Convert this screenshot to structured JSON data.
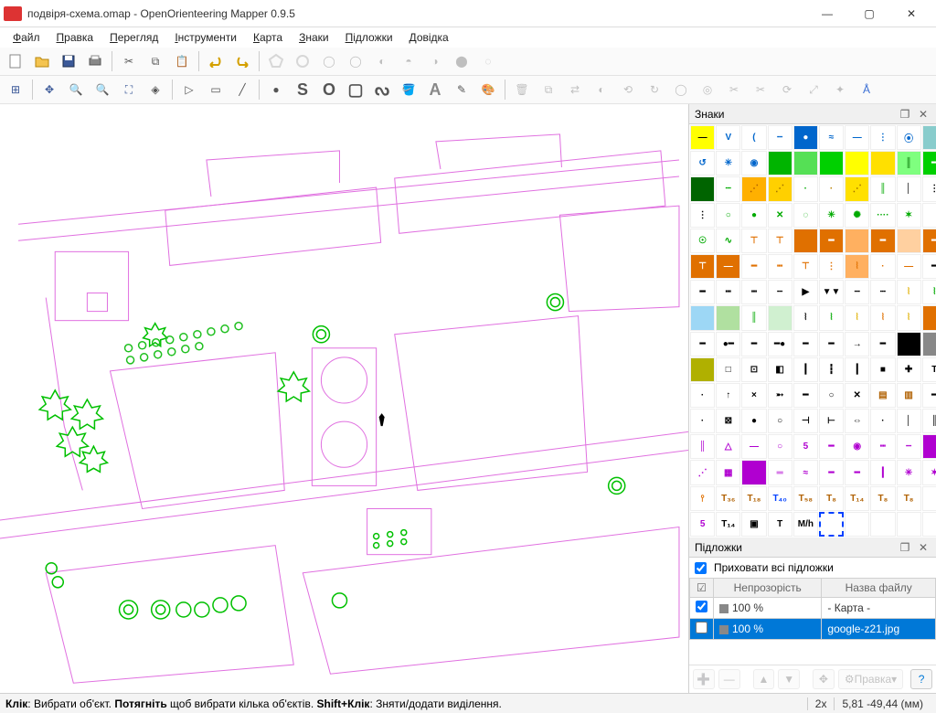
{
  "window": {
    "title": "подвіря-схема.omap - OpenOrienteering Mapper 0.9.5"
  },
  "menu": [
    "Файл",
    "Правка",
    "Перегляд",
    "Інструменти",
    "Карта",
    "Знаки",
    "Підложки",
    "Довідка"
  ],
  "panels": {
    "symbols_title": "Знаки",
    "templates_title": "Підложки",
    "hide_all_label": "Приховати всі підложки",
    "hide_all_checked": true
  },
  "templates_table": {
    "headers": [
      "",
      "Непрозорість",
      "Назва файлу"
    ],
    "rows": [
      {
        "checked": true,
        "opacity": "100 %",
        "name": "- Карта -",
        "selected": false
      },
      {
        "checked": false,
        "opacity": "100 %",
        "name": "google-z21.jpg",
        "selected": true
      }
    ]
  },
  "templates_actions": {
    "edit_label": "Правка"
  },
  "statusbar": {
    "hint_html": "<b>Клік</b>: Вибрати об'єкт. <b>Потягніть</b> щоб вибрати кілька об'єктів. <b>Shift+Клік</b>: Зняти/додати виділення.",
    "zoom": "2x",
    "coords": "5,81 -49,44 (мм)"
  },
  "symbols": [
    {
      "bg": "#ff0",
      "fg": "#000",
      "t": "—"
    },
    {
      "bg": "#fff",
      "fg": "#0066cc",
      "t": "V"
    },
    {
      "bg": "#fff",
      "fg": "#0066cc",
      "t": "("
    },
    {
      "bg": "#fff",
      "fg": "#0066cc",
      "t": "┄"
    },
    {
      "bg": "#0066cc",
      "fg": "#fff",
      "t": "●"
    },
    {
      "bg": "#fff",
      "fg": "#0066cc",
      "t": "≈"
    },
    {
      "bg": "#fff",
      "fg": "#0066cc",
      "t": "—"
    },
    {
      "bg": "#fff",
      "fg": "#0066cc",
      "t": "⋮"
    },
    {
      "bg": "#fff",
      "fg": "#0066cc",
      "t": "⦿"
    },
    {
      "bg": "#8cc",
      "fg": "#fff",
      "t": ""
    },
    {
      "bg": "#fff",
      "fg": "#06c",
      "t": "↺"
    },
    {
      "bg": "#fff",
      "fg": "#06c",
      "t": "✳"
    },
    {
      "bg": "#fff",
      "fg": "#06c",
      "t": "◉"
    },
    {
      "bg": "#00b400",
      "fg": "#fff",
      "t": ""
    },
    {
      "bg": "#55e055",
      "fg": "#fff",
      "t": ""
    },
    {
      "bg": "#00d000",
      "fg": "#fff",
      "t": ""
    },
    {
      "bg": "#ff0",
      "fg": "#000",
      "t": ""
    },
    {
      "bg": "#ffe000",
      "fg": "#000",
      "t": ""
    },
    {
      "bg": "#7fff7f",
      "fg": "#007000",
      "t": "║"
    },
    {
      "bg": "#00d000",
      "fg": "#fff",
      "t": "━"
    },
    {
      "bg": "#006400",
      "fg": "#fff",
      "t": ""
    },
    {
      "bg": "#fff",
      "fg": "#0a0",
      "t": "┈"
    },
    {
      "bg": "#ffb000",
      "fg": "#b06000",
      "t": "⋰"
    },
    {
      "bg": "#ffd000",
      "fg": "#a07000",
      "t": "⋰"
    },
    {
      "bg": "#fff",
      "fg": "#0a0",
      "t": "·"
    },
    {
      "bg": "#fff",
      "fg": "#b88000",
      "t": "·"
    },
    {
      "bg": "#ffe000",
      "fg": "#a07000",
      "t": "⋰"
    },
    {
      "bg": "#fff",
      "fg": "#0a0",
      "t": "║"
    },
    {
      "bg": "#fff",
      "fg": "#000",
      "t": "│"
    },
    {
      "bg": "#fff",
      "fg": "#000",
      "t": "⋮"
    },
    {
      "bg": "#fff",
      "fg": "#000",
      "t": "⋮"
    },
    {
      "bg": "#fff",
      "fg": "#0a0",
      "t": "○"
    },
    {
      "bg": "#fff",
      "fg": "#0a0",
      "t": "●"
    },
    {
      "bg": "#fff",
      "fg": "#0a0",
      "t": "✕"
    },
    {
      "bg": "#fff",
      "fg": "#0a0",
      "t": "◌"
    },
    {
      "bg": "#fff",
      "fg": "#0a0",
      "t": "✳"
    },
    {
      "bg": "#fff",
      "fg": "#0a0",
      "t": "✺"
    },
    {
      "bg": "#fff",
      "fg": "#0a0",
      "t": "····"
    },
    {
      "bg": "#fff",
      "fg": "#0a0",
      "t": "✶"
    },
    {
      "bg": "#fff",
      "fg": "#000",
      "t": ""
    },
    {
      "bg": "#fff",
      "fg": "#0a0",
      "t": "☉"
    },
    {
      "bg": "#fff",
      "fg": "#0a0",
      "t": "∿"
    },
    {
      "bg": "#fff",
      "fg": "#e07000",
      "t": "⊤"
    },
    {
      "bg": "#fff",
      "fg": "#e07000",
      "t": "⊤"
    },
    {
      "bg": "#e07000",
      "fg": "#fff",
      "t": ""
    },
    {
      "bg": "#e07000",
      "fg": "#fff",
      "t": "━"
    },
    {
      "bg": "#ffb060",
      "fg": "#fff",
      "t": ""
    },
    {
      "bg": "#e07000",
      "fg": "#fff",
      "t": "━"
    },
    {
      "bg": "#ffd0a0",
      "fg": "#fff",
      "t": ""
    },
    {
      "bg": "#e07000",
      "fg": "#fff",
      "t": "━"
    },
    {
      "bg": "#e07000",
      "fg": "#fff",
      "t": "⊤"
    },
    {
      "bg": "#e07000",
      "fg": "#fff",
      "t": "—"
    },
    {
      "bg": "#fff",
      "fg": "#e07000",
      "t": "━"
    },
    {
      "bg": "#fff",
      "fg": "#e07000",
      "t": "┉"
    },
    {
      "bg": "#fff",
      "fg": "#e07000",
      "t": "⊤"
    },
    {
      "bg": "#fff",
      "fg": "#e07000",
      "t": "⋮"
    },
    {
      "bg": "#ffb060",
      "fg": "#e07000",
      "t": "⦚"
    },
    {
      "bg": "#fff",
      "fg": "#e07000",
      "t": "·"
    },
    {
      "bg": "#fff",
      "fg": "#e07000",
      "t": "—"
    },
    {
      "bg": "#fff",
      "fg": "#000",
      "t": "━"
    },
    {
      "bg": "#fff",
      "fg": "#000",
      "t": "━"
    },
    {
      "bg": "#fff",
      "fg": "#000",
      "t": "┉"
    },
    {
      "bg": "#fff",
      "fg": "#000",
      "t": "┉"
    },
    {
      "bg": "#fff",
      "fg": "#000",
      "t": "┄"
    },
    {
      "bg": "#fff",
      "fg": "#000",
      "t": "▶"
    },
    {
      "bg": "#fff",
      "fg": "#000",
      "t": "▼▼"
    },
    {
      "bg": "#fff",
      "fg": "#000",
      "t": "┄"
    },
    {
      "bg": "#fff",
      "fg": "#000",
      "t": "┄"
    },
    {
      "bg": "#fff",
      "fg": "#e0b000",
      "t": "⦚"
    },
    {
      "bg": "#fff",
      "fg": "#0a0",
      "t": "⦚"
    },
    {
      "bg": "#9dd7f5",
      "fg": "#fff",
      "t": ""
    },
    {
      "bg": "#b0e0a0",
      "fg": "#fff",
      "t": ""
    },
    {
      "bg": "#fff",
      "fg": "#0a0",
      "t": "║"
    },
    {
      "bg": "#d0f0d0",
      "fg": "#fff",
      "t": ""
    },
    {
      "bg": "#fff",
      "fg": "#000",
      "t": "⦚"
    },
    {
      "bg": "#fff",
      "fg": "#0a0",
      "t": "⦚"
    },
    {
      "bg": "#fff",
      "fg": "#e0b000",
      "t": "⦚"
    },
    {
      "bg": "#fff",
      "fg": "#e07000",
      "t": "⦚"
    },
    {
      "bg": "#fff",
      "fg": "#e0b000",
      "t": "⦚"
    },
    {
      "bg": "#e07000",
      "fg": "#fff",
      "t": ""
    },
    {
      "bg": "#fff",
      "fg": "#000",
      "t": "━"
    },
    {
      "bg": "#fff",
      "fg": "#000",
      "t": "●━"
    },
    {
      "bg": "#fff",
      "fg": "#000",
      "t": "━"
    },
    {
      "bg": "#fff",
      "fg": "#000",
      "t": "━●"
    },
    {
      "bg": "#fff",
      "fg": "#000",
      "t": "━"
    },
    {
      "bg": "#fff",
      "fg": "#000",
      "t": "━"
    },
    {
      "bg": "#fff",
      "fg": "#000",
      "t": "→"
    },
    {
      "bg": "#fff",
      "fg": "#000",
      "t": "━"
    },
    {
      "bg": "#000",
      "fg": "#fff",
      "t": ""
    },
    {
      "bg": "#888",
      "fg": "#fff",
      "t": ""
    },
    {
      "bg": "#b0b000",
      "fg": "#fff",
      "t": ""
    },
    {
      "bg": "#fff",
      "fg": "#000",
      "t": "□"
    },
    {
      "bg": "#fff",
      "fg": "#000",
      "t": "⊡"
    },
    {
      "bg": "#fff",
      "fg": "#000",
      "t": "◧"
    },
    {
      "bg": "#fff",
      "fg": "#000",
      "t": "┃"
    },
    {
      "bg": "#fff",
      "fg": "#000",
      "t": "┇"
    },
    {
      "bg": "#fff",
      "fg": "#000",
      "t": "┃"
    },
    {
      "bg": "#fff",
      "fg": "#000",
      "t": "■"
    },
    {
      "bg": "#fff",
      "fg": "#000",
      "t": "✚"
    },
    {
      "bg": "#fff",
      "fg": "#000",
      "t": "T"
    },
    {
      "bg": "#fff",
      "fg": "#000",
      "t": "·"
    },
    {
      "bg": "#fff",
      "fg": "#000",
      "t": "↑"
    },
    {
      "bg": "#fff",
      "fg": "#000",
      "t": "×"
    },
    {
      "bg": "#fff",
      "fg": "#000",
      "t": "➵"
    },
    {
      "bg": "#fff",
      "fg": "#000",
      "t": "━"
    },
    {
      "bg": "#fff",
      "fg": "#000",
      "t": "○"
    },
    {
      "bg": "#fff",
      "fg": "#000",
      "t": "✕"
    },
    {
      "bg": "#fff",
      "fg": "#b06000",
      "t": "▤"
    },
    {
      "bg": "#fff",
      "fg": "#b06000",
      "t": "▥"
    },
    {
      "bg": "#fff",
      "fg": "#000",
      "t": "━"
    },
    {
      "bg": "#fff",
      "fg": "#000",
      "t": "·"
    },
    {
      "bg": "#fff",
      "fg": "#000",
      "t": "⊠"
    },
    {
      "bg": "#fff",
      "fg": "#000",
      "t": "●"
    },
    {
      "bg": "#fff",
      "fg": "#000",
      "t": "○"
    },
    {
      "bg": "#fff",
      "fg": "#000",
      "t": "⊣"
    },
    {
      "bg": "#fff",
      "fg": "#000",
      "t": "⊢"
    },
    {
      "bg": "#fff",
      "fg": "#000",
      "t": "⇔"
    },
    {
      "bg": "#fff",
      "fg": "#000",
      "t": "·"
    },
    {
      "bg": "#fff",
      "fg": "#000",
      "t": "│"
    },
    {
      "bg": "#fff",
      "fg": "#000",
      "t": "║"
    },
    {
      "bg": "#fff",
      "fg": "#b000d0",
      "t": "║"
    },
    {
      "bg": "#fff",
      "fg": "#b000d0",
      "t": "△"
    },
    {
      "bg": "#fff",
      "fg": "#b000d0",
      "t": "—"
    },
    {
      "bg": "#fff",
      "fg": "#b000d0",
      "t": "○"
    },
    {
      "bg": "#fff",
      "fg": "#b000d0",
      "t": "5"
    },
    {
      "bg": "#fff",
      "fg": "#b000d0",
      "t": "━"
    },
    {
      "bg": "#fff",
      "fg": "#b000d0",
      "t": "◉"
    },
    {
      "bg": "#fff",
      "fg": "#b000d0",
      "t": "┉"
    },
    {
      "bg": "#fff",
      "fg": "#b000d0",
      "t": "┄"
    },
    {
      "bg": "#b000d0",
      "fg": "#fff",
      "t": ""
    },
    {
      "bg": "#fff",
      "fg": "#b000d0",
      "t": "⋰"
    },
    {
      "bg": "#fff",
      "fg": "#b000d0",
      "t": "▦"
    },
    {
      "bg": "#b000d0",
      "fg": "#fff",
      "t": ""
    },
    {
      "bg": "#fff",
      "fg": "#b000d0",
      "t": "═"
    },
    {
      "bg": "#fff",
      "fg": "#b000d0",
      "t": "≈"
    },
    {
      "bg": "#fff",
      "fg": "#b000d0",
      "t": "━"
    },
    {
      "bg": "#fff",
      "fg": "#b000d0",
      "t": "━"
    },
    {
      "bg": "#fff",
      "fg": "#b000d0",
      "t": "┃"
    },
    {
      "bg": "#fff",
      "fg": "#b000d0",
      "t": "✳"
    },
    {
      "bg": "#fff",
      "fg": "#b000d0",
      "t": "✶"
    },
    {
      "bg": "#fff",
      "fg": "#e07000",
      "t": "⫯"
    },
    {
      "bg": "#fff",
      "fg": "#b06000",
      "t": "T₃₆"
    },
    {
      "bg": "#fff",
      "fg": "#b06000",
      "t": "T₁₈"
    },
    {
      "bg": "#fff",
      "fg": "#0040ff",
      "t": "T₄₀"
    },
    {
      "bg": "#fff",
      "fg": "#b06000",
      "t": "T₅₈"
    },
    {
      "bg": "#fff",
      "fg": "#b06000",
      "t": "T₈"
    },
    {
      "bg": "#fff",
      "fg": "#b06000",
      "t": "T₁₄"
    },
    {
      "bg": "#fff",
      "fg": "#b06000",
      "t": "T₈"
    },
    {
      "bg": "#fff",
      "fg": "#b06000",
      "t": "T₈"
    },
    {
      "bg": "#fff",
      "fg": "#000",
      "t": ""
    },
    {
      "bg": "#fff",
      "fg": "#b000d0",
      "t": "5"
    },
    {
      "bg": "#fff",
      "fg": "#000",
      "t": "T₁₄"
    },
    {
      "bg": "#fff",
      "fg": "#000",
      "t": "▣"
    },
    {
      "bg": "#fff",
      "fg": "#000",
      "t": "T"
    },
    {
      "bg": "#fff",
      "fg": "#000",
      "t": "M/h"
    },
    {
      "bg": "#fff",
      "fg": "#0040ff",
      "t": "",
      "sel": true
    },
    {
      "bg": "#fff",
      "fg": "#000",
      "t": ""
    },
    {
      "bg": "#fff",
      "fg": "#000",
      "t": ""
    },
    {
      "bg": "#fff",
      "fg": "#000",
      "t": ""
    },
    {
      "bg": "#fff",
      "fg": "#000",
      "t": ""
    }
  ]
}
